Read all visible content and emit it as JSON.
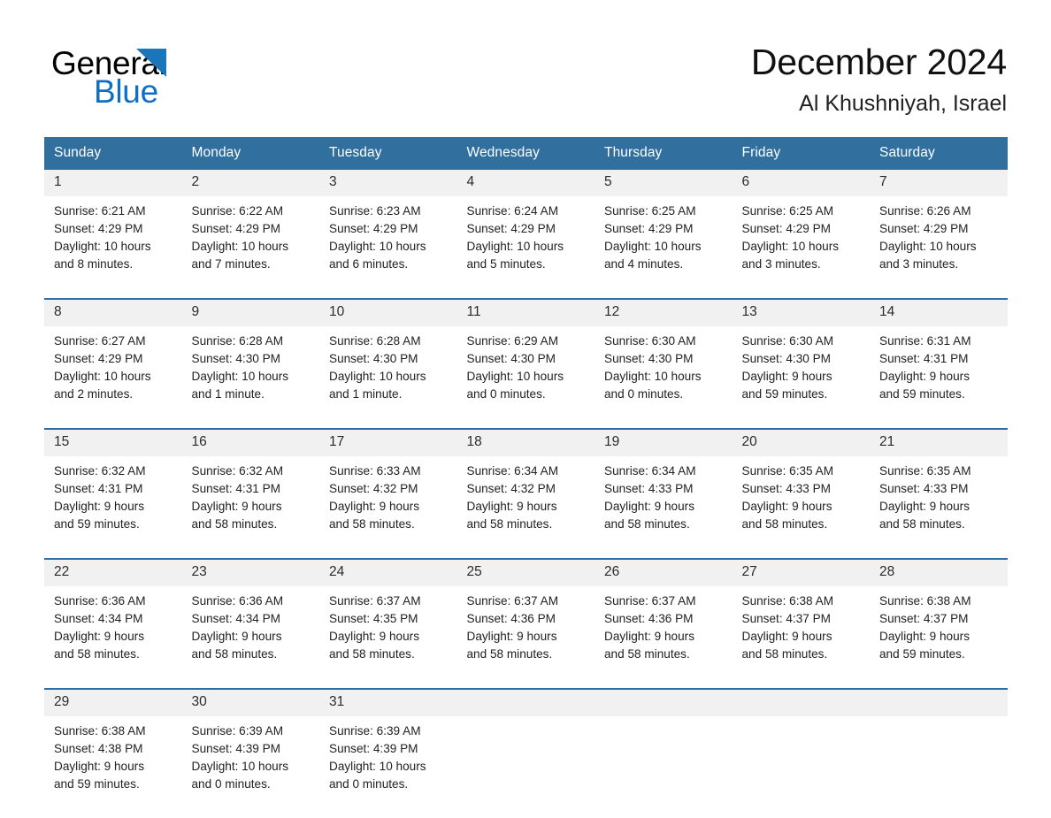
{
  "brand": {
    "name_part1": "General",
    "name_part2": "Blue",
    "logo_icon": "triangle-logo-icon"
  },
  "header": {
    "title": "December 2024",
    "location": "Al Khushniyah, Israel"
  },
  "colors": {
    "header_blue": "#31709e",
    "week_separator": "#2f6fa6",
    "date_band": "#f1f1f1",
    "brand_blue": "#0f6fc5"
  },
  "weekday_headers": [
    "Sunday",
    "Monday",
    "Tuesday",
    "Wednesday",
    "Thursday",
    "Friday",
    "Saturday"
  ],
  "weeks": [
    {
      "days": [
        {
          "date": "1",
          "sunrise": "Sunrise: 6:21 AM",
          "sunset": "Sunset: 4:29 PM",
          "daylight_line1": "Daylight: 10 hours",
          "daylight_line2": "and 8 minutes."
        },
        {
          "date": "2",
          "sunrise": "Sunrise: 6:22 AM",
          "sunset": "Sunset: 4:29 PM",
          "daylight_line1": "Daylight: 10 hours",
          "daylight_line2": "and 7 minutes."
        },
        {
          "date": "3",
          "sunrise": "Sunrise: 6:23 AM",
          "sunset": "Sunset: 4:29 PM",
          "daylight_line1": "Daylight: 10 hours",
          "daylight_line2": "and 6 minutes."
        },
        {
          "date": "4",
          "sunrise": "Sunrise: 6:24 AM",
          "sunset": "Sunset: 4:29 PM",
          "daylight_line1": "Daylight: 10 hours",
          "daylight_line2": "and 5 minutes."
        },
        {
          "date": "5",
          "sunrise": "Sunrise: 6:25 AM",
          "sunset": "Sunset: 4:29 PM",
          "daylight_line1": "Daylight: 10 hours",
          "daylight_line2": "and 4 minutes."
        },
        {
          "date": "6",
          "sunrise": "Sunrise: 6:25 AM",
          "sunset": "Sunset: 4:29 PM",
          "daylight_line1": "Daylight: 10 hours",
          "daylight_line2": "and 3 minutes."
        },
        {
          "date": "7",
          "sunrise": "Sunrise: 6:26 AM",
          "sunset": "Sunset: 4:29 PM",
          "daylight_line1": "Daylight: 10 hours",
          "daylight_line2": "and 3 minutes."
        }
      ]
    },
    {
      "days": [
        {
          "date": "8",
          "sunrise": "Sunrise: 6:27 AM",
          "sunset": "Sunset: 4:29 PM",
          "daylight_line1": "Daylight: 10 hours",
          "daylight_line2": "and 2 minutes."
        },
        {
          "date": "9",
          "sunrise": "Sunrise: 6:28 AM",
          "sunset": "Sunset: 4:30 PM",
          "daylight_line1": "Daylight: 10 hours",
          "daylight_line2": "and 1 minute."
        },
        {
          "date": "10",
          "sunrise": "Sunrise: 6:28 AM",
          "sunset": "Sunset: 4:30 PM",
          "daylight_line1": "Daylight: 10 hours",
          "daylight_line2": "and 1 minute."
        },
        {
          "date": "11",
          "sunrise": "Sunrise: 6:29 AM",
          "sunset": "Sunset: 4:30 PM",
          "daylight_line1": "Daylight: 10 hours",
          "daylight_line2": "and 0 minutes."
        },
        {
          "date": "12",
          "sunrise": "Sunrise: 6:30 AM",
          "sunset": "Sunset: 4:30 PM",
          "daylight_line1": "Daylight: 10 hours",
          "daylight_line2": "and 0 minutes."
        },
        {
          "date": "13",
          "sunrise": "Sunrise: 6:30 AM",
          "sunset": "Sunset: 4:30 PM",
          "daylight_line1": "Daylight: 9 hours",
          "daylight_line2": "and 59 minutes."
        },
        {
          "date": "14",
          "sunrise": "Sunrise: 6:31 AM",
          "sunset": "Sunset: 4:31 PM",
          "daylight_line1": "Daylight: 9 hours",
          "daylight_line2": "and 59 minutes."
        }
      ]
    },
    {
      "days": [
        {
          "date": "15",
          "sunrise": "Sunrise: 6:32 AM",
          "sunset": "Sunset: 4:31 PM",
          "daylight_line1": "Daylight: 9 hours",
          "daylight_line2": "and 59 minutes."
        },
        {
          "date": "16",
          "sunrise": "Sunrise: 6:32 AM",
          "sunset": "Sunset: 4:31 PM",
          "daylight_line1": "Daylight: 9 hours",
          "daylight_line2": "and 58 minutes."
        },
        {
          "date": "17",
          "sunrise": "Sunrise: 6:33 AM",
          "sunset": "Sunset: 4:32 PM",
          "daylight_line1": "Daylight: 9 hours",
          "daylight_line2": "and 58 minutes."
        },
        {
          "date": "18",
          "sunrise": "Sunrise: 6:34 AM",
          "sunset": "Sunset: 4:32 PM",
          "daylight_line1": "Daylight: 9 hours",
          "daylight_line2": "and 58 minutes."
        },
        {
          "date": "19",
          "sunrise": "Sunrise: 6:34 AM",
          "sunset": "Sunset: 4:33 PM",
          "daylight_line1": "Daylight: 9 hours",
          "daylight_line2": "and 58 minutes."
        },
        {
          "date": "20",
          "sunrise": "Sunrise: 6:35 AM",
          "sunset": "Sunset: 4:33 PM",
          "daylight_line1": "Daylight: 9 hours",
          "daylight_line2": "and 58 minutes."
        },
        {
          "date": "21",
          "sunrise": "Sunrise: 6:35 AM",
          "sunset": "Sunset: 4:33 PM",
          "daylight_line1": "Daylight: 9 hours",
          "daylight_line2": "and 58 minutes."
        }
      ]
    },
    {
      "days": [
        {
          "date": "22",
          "sunrise": "Sunrise: 6:36 AM",
          "sunset": "Sunset: 4:34 PM",
          "daylight_line1": "Daylight: 9 hours",
          "daylight_line2": "and 58 minutes."
        },
        {
          "date": "23",
          "sunrise": "Sunrise: 6:36 AM",
          "sunset": "Sunset: 4:34 PM",
          "daylight_line1": "Daylight: 9 hours",
          "daylight_line2": "and 58 minutes."
        },
        {
          "date": "24",
          "sunrise": "Sunrise: 6:37 AM",
          "sunset": "Sunset: 4:35 PM",
          "daylight_line1": "Daylight: 9 hours",
          "daylight_line2": "and 58 minutes."
        },
        {
          "date": "25",
          "sunrise": "Sunrise: 6:37 AM",
          "sunset": "Sunset: 4:36 PM",
          "daylight_line1": "Daylight: 9 hours",
          "daylight_line2": "and 58 minutes."
        },
        {
          "date": "26",
          "sunrise": "Sunrise: 6:37 AM",
          "sunset": "Sunset: 4:36 PM",
          "daylight_line1": "Daylight: 9 hours",
          "daylight_line2": "and 58 minutes."
        },
        {
          "date": "27",
          "sunrise": "Sunrise: 6:38 AM",
          "sunset": "Sunset: 4:37 PM",
          "daylight_line1": "Daylight: 9 hours",
          "daylight_line2": "and 58 minutes."
        },
        {
          "date": "28",
          "sunrise": "Sunrise: 6:38 AM",
          "sunset": "Sunset: 4:37 PM",
          "daylight_line1": "Daylight: 9 hours",
          "daylight_line2": "and 59 minutes."
        }
      ]
    },
    {
      "days": [
        {
          "date": "29",
          "sunrise": "Sunrise: 6:38 AM",
          "sunset": "Sunset: 4:38 PM",
          "daylight_line1": "Daylight: 9 hours",
          "daylight_line2": "and 59 minutes."
        },
        {
          "date": "30",
          "sunrise": "Sunrise: 6:39 AM",
          "sunset": "Sunset: 4:39 PM",
          "daylight_line1": "Daylight: 10 hours",
          "daylight_line2": "and 0 minutes."
        },
        {
          "date": "31",
          "sunrise": "Sunrise: 6:39 AM",
          "sunset": "Sunset: 4:39 PM",
          "daylight_line1": "Daylight: 10 hours",
          "daylight_line2": "and 0 minutes."
        },
        {
          "date": "",
          "sunrise": "",
          "sunset": "",
          "daylight_line1": "",
          "daylight_line2": ""
        },
        {
          "date": "",
          "sunrise": "",
          "sunset": "",
          "daylight_line1": "",
          "daylight_line2": ""
        },
        {
          "date": "",
          "sunrise": "",
          "sunset": "",
          "daylight_line1": "",
          "daylight_line2": ""
        },
        {
          "date": "",
          "sunrise": "",
          "sunset": "",
          "daylight_line1": "",
          "daylight_line2": ""
        }
      ]
    }
  ]
}
